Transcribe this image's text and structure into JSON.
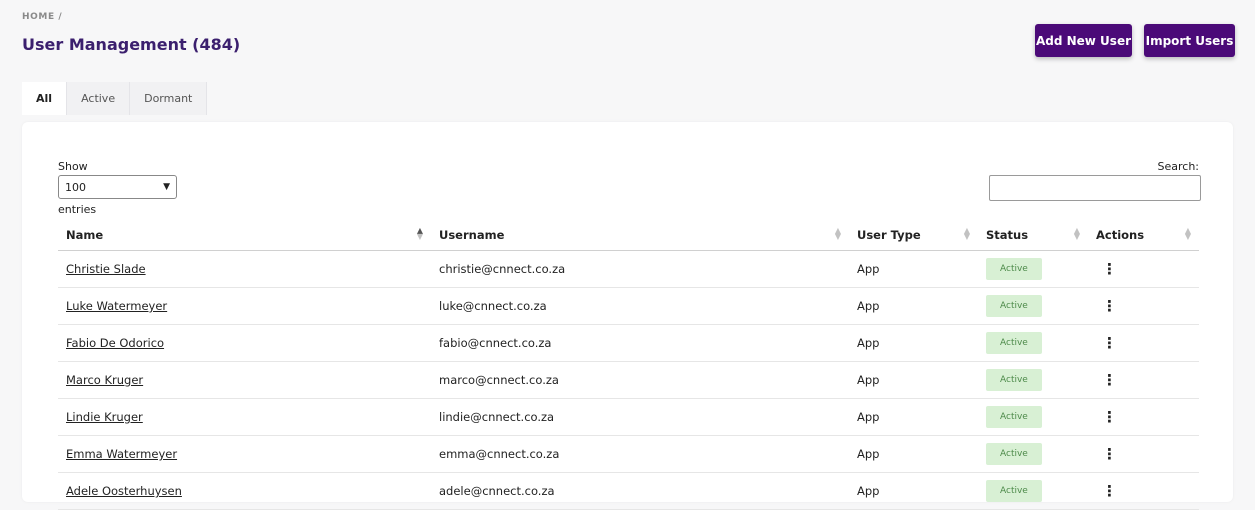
{
  "breadcrumb": "HOME /",
  "title": "User Management (484)",
  "buttons": {
    "add": "Add New User",
    "import": "Import Users"
  },
  "tabs": [
    "All",
    "Active",
    "Dormant"
  ],
  "length": {
    "show": "Show",
    "value": "100",
    "entries": "entries"
  },
  "search": {
    "label": "Search:",
    "value": ""
  },
  "columns": [
    "Name",
    "Username",
    "User Type",
    "Status",
    "Actions"
  ],
  "rows": [
    {
      "name": "Christie Slade",
      "username": "christie@cnnect.co.za",
      "type": "App",
      "status": "Active"
    },
    {
      "name": "Luke Watermeyer",
      "username": "luke@cnnect.co.za",
      "type": "App",
      "status": "Active"
    },
    {
      "name": "Fabio De Odorico",
      "username": "fabio@cnnect.co.za",
      "type": "App",
      "status": "Active"
    },
    {
      "name": "Marco Kruger",
      "username": "marco@cnnect.co.za",
      "type": "App",
      "status": "Active"
    },
    {
      "name": "Lindie Kruger",
      "username": "lindie@cnnect.co.za",
      "type": "App",
      "status": "Active"
    },
    {
      "name": "Emma Watermeyer",
      "username": "emma@cnnect.co.za",
      "type": "App",
      "status": "Active"
    },
    {
      "name": "Adele Oosterhuysen",
      "username": "adele@cnnect.co.za",
      "type": "App",
      "status": "Active"
    }
  ]
}
